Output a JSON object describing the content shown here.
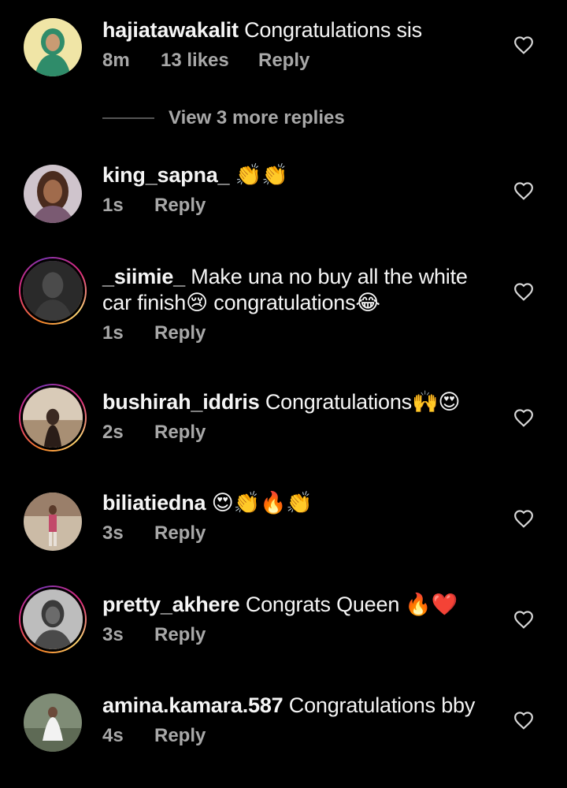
{
  "view_more_replies": "View 3 more replies",
  "comments": [
    {
      "username": "hajiatawakalit",
      "text": "Congratulations sis",
      "time": "8m",
      "likes": "13 likes",
      "reply": "Reply",
      "ring": false,
      "avatar_color": "#f0e5a6"
    },
    {
      "username": "king_sapna_",
      "text": "👏👏",
      "time": "1s",
      "reply": "Reply",
      "ring": false,
      "avatar_color": "#7a5a72"
    },
    {
      "username": "_siimie_",
      "text_line1": "Make una no buy all the white",
      "text_line2": "car finish😢 congratulations😂",
      "time": "1s",
      "reply": "Reply",
      "ring": true,
      "avatar_color": "#2a2a2a"
    },
    {
      "username": "bushirah_iddris",
      "text": "Congratulations🙌😍",
      "time": "2s",
      "reply": "Reply",
      "ring": true,
      "avatar_color": "#c9b6a0"
    },
    {
      "username": "biliatiedna",
      "text": "😍👏🔥👏",
      "time": "3s",
      "reply": "Reply",
      "ring": false,
      "avatar_color": "#b8a593"
    },
    {
      "username": "pretty_akhere",
      "text": "Congrats Queen 🔥❤️",
      "time": "3s",
      "reply": "Reply",
      "ring": true,
      "avatar_color": "#9a9a9a"
    },
    {
      "username": "amina.kamara.587",
      "text": "Congratulations bby",
      "time": "4s",
      "reply": "Reply",
      "ring": false,
      "avatar_color": "#7f8c76"
    }
  ],
  "colors": {
    "background": "#000000",
    "text": "#f5f5f5",
    "muted": "#a8a8a8",
    "ring_start": "#f58529",
    "ring_end": "#dd2a7b"
  }
}
